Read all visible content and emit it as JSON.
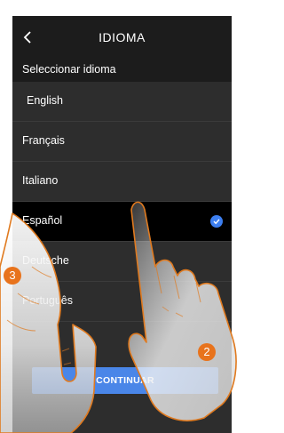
{
  "header": {
    "title": "IDIOMA",
    "back_icon": "chevron-left-icon"
  },
  "subheader": {
    "label": "Seleccionar idioma"
  },
  "languages": [
    {
      "label": "English",
      "selected": false
    },
    {
      "label": "Français",
      "selected": false
    },
    {
      "label": "Italiano",
      "selected": false
    },
    {
      "label": "Español",
      "selected": true
    },
    {
      "label": "Deutsche",
      "selected": false
    },
    {
      "label": "Português",
      "selected": false
    }
  ],
  "button": {
    "continue_label": "CONTINUAR"
  },
  "steps": {
    "step_2": "2",
    "step_3": "3"
  },
  "colors": {
    "background": "#2d2d2d",
    "header": "#1c1c1c",
    "selected_row": "#000000",
    "accent": "#4a86e8",
    "badge": "#e8731c"
  }
}
